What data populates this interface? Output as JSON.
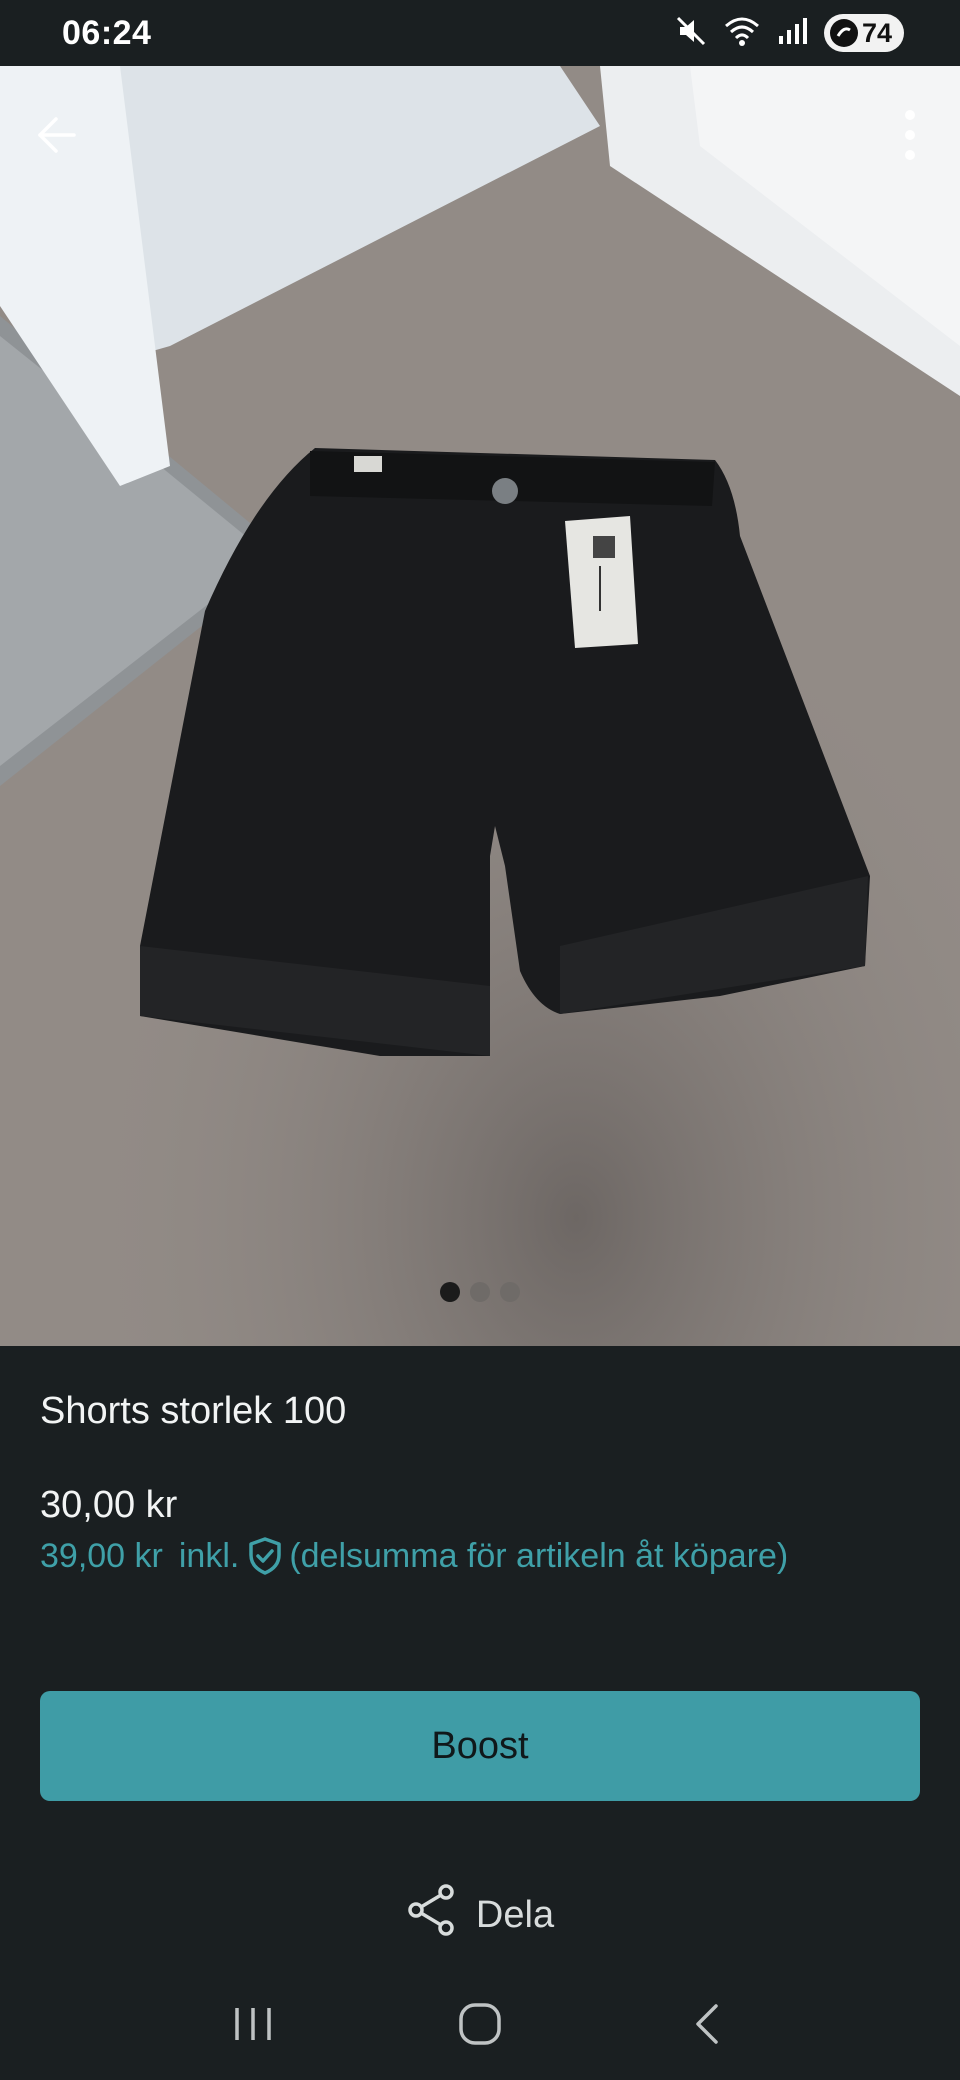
{
  "status_bar": {
    "time": "06:24",
    "battery": "74",
    "icons": [
      "mute-icon",
      "wifi-icon",
      "signal-icon",
      "battery-saver-icon"
    ]
  },
  "gallery": {
    "image_count": 3,
    "active_index": 0,
    "back_icon": "arrow-left-icon",
    "more_icon": "more-vertical-icon"
  },
  "listing": {
    "title": "Shorts storlek 100",
    "price": "30,00 kr",
    "buyer_price": "39,00 kr",
    "incl_label": "inkl.",
    "incl_note": "(delsumma för artikeln åt köpare)"
  },
  "actions": {
    "boost_label": "Boost",
    "share_label": "Dela"
  },
  "colors": {
    "background": "#1a1f21",
    "accent": "#3f9ca6",
    "accent_text": "#3fa0a8"
  }
}
